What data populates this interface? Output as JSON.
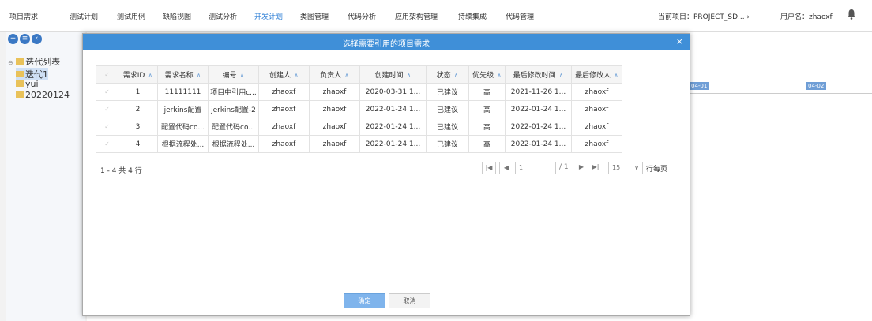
{
  "topnav": {
    "items": [
      {
        "label": "项目需求"
      },
      {
        "label": "测试计划"
      },
      {
        "label": "测试用例"
      },
      {
        "label": "缺陷视图"
      },
      {
        "label": "测试分析"
      },
      {
        "label": "开发计划"
      },
      {
        "label": "类图管理"
      },
      {
        "label": "代码分析"
      },
      {
        "label": "应用架构管理"
      },
      {
        "label": "持续集成"
      },
      {
        "label": "代码管理"
      }
    ],
    "active_index": 5,
    "project": "当前项目：PROJECT_SD... ›",
    "user": "用户名：zhaoxf",
    "bell_icon": "bell-icon",
    "accent_color": "#2e7fd6"
  },
  "leftpanel": {
    "circle_icons": [
      "plus-circle-icon",
      "gear-circle-icon",
      "back-circle-icon"
    ],
    "tree": {
      "root": "迭代列表",
      "items": [
        "迭代1",
        "yui",
        "20220124"
      ]
    }
  },
  "background": {
    "dates": [
      "04-01",
      "04-02"
    ]
  },
  "modal": {
    "title": "选择需要引用的项目需求",
    "close": "×",
    "header_color": "#3f8fd8",
    "columns": [
      "需求ID",
      "需求名称",
      "编号",
      "创建人",
      "负责人",
      "创建时间",
      "状态",
      "优先级",
      "最后修改时间",
      "最后修改人"
    ],
    "rows": [
      [
        "1",
        "11111111",
        "项目中引用c...",
        "zhaoxf",
        "zhaoxf",
        "2020-03-31 1...",
        "已建议",
        "高",
        "2021-11-26 1...",
        "zhaoxf"
      ],
      [
        "2",
        "jerkins配置",
        "jerkins配置-2",
        "zhaoxf",
        "zhaoxf",
        "2022-01-24 1...",
        "已建议",
        "高",
        "2022-01-24 1...",
        "zhaoxf"
      ],
      [
        "3",
        "配置代码co...",
        "配置代码co...",
        "zhaoxf",
        "zhaoxf",
        "2022-01-24 1...",
        "已建议",
        "高",
        "2022-01-24 1...",
        "zhaoxf"
      ],
      [
        "4",
        "根据流程处...",
        "根据流程处...",
        "zhaoxf",
        "zhaoxf",
        "2022-01-24 1...",
        "已建议",
        "高",
        "2022-01-24 1...",
        "zhaoxf"
      ]
    ],
    "pager": {
      "info": "1 - 4 共 4 行",
      "first": "|◀",
      "prev": "◀",
      "page": "1",
      "total": "/ 1",
      "next": "▶",
      "last": "▶|",
      "page_size": "15",
      "per_page_label": "行每页"
    },
    "ok_label": "确定",
    "cancel_label": "取消"
  }
}
